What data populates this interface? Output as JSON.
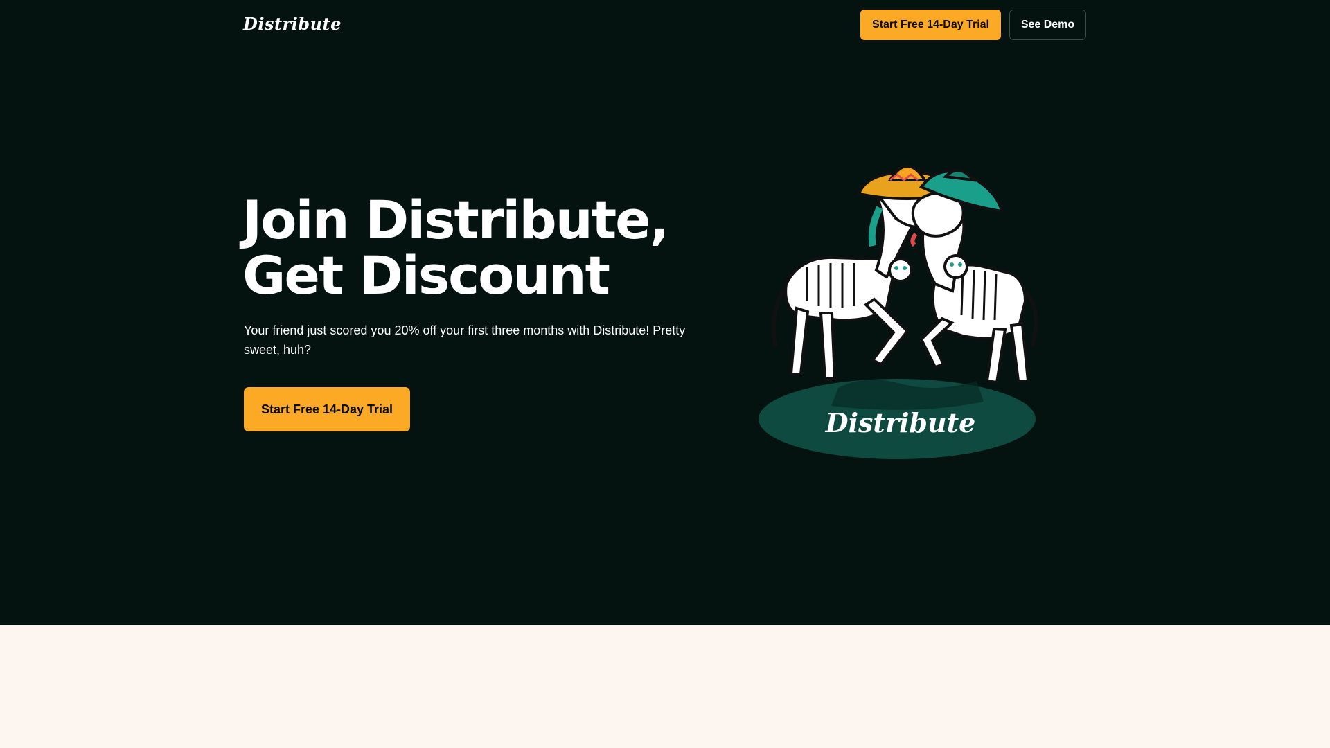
{
  "header": {
    "logo": "Distribute",
    "trial_label": "Start Free 14-Day Trial",
    "demo_label": "See Demo"
  },
  "hero": {
    "headline_line1": "Join Distribute,",
    "headline_line2": "Get Discount",
    "subtext": "Your friend just scored you 20% off your first three months with Distribute! Pretty sweet, huh?",
    "cta_label": "Start Free 14-Day Trial",
    "illustration_label": "Distribute"
  },
  "colors": {
    "hero_background": "#041210",
    "accent": "#fca926",
    "lower_background": "#fdf6f0",
    "illustration_base": "#0f4a40"
  }
}
